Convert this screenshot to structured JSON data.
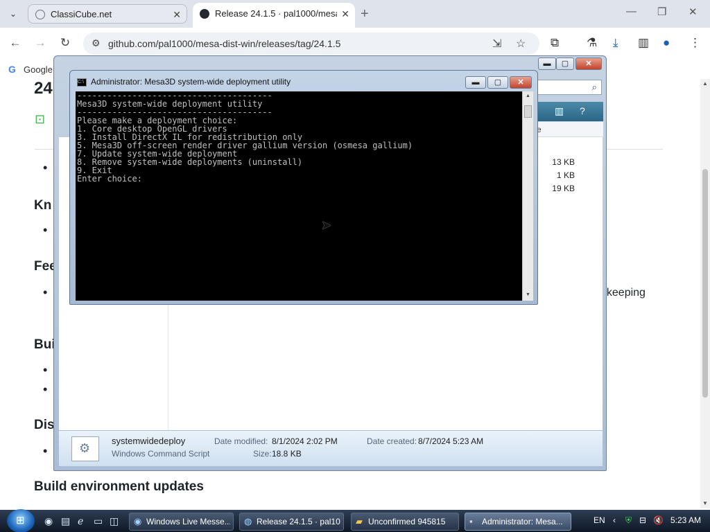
{
  "browser": {
    "tab_dropdown_icon": "chevron-down-icon",
    "tabs": [
      {
        "title": "ClassiCube.net",
        "close": "✕"
      },
      {
        "title": "Release 24.1.5 · pal1000/mesa",
        "close": "✕"
      }
    ],
    "new_tab": "+",
    "window_controls": {
      "minimize": "—",
      "restore": "❐",
      "close": "✕"
    },
    "nav": {
      "back": "←",
      "forward": "→",
      "reload": "↻"
    },
    "url": "github.com/pal1000/mesa-dist-win/releases/tag/24.1.5",
    "bookmark": {
      "label": "Google",
      "icon_letter": "G"
    }
  },
  "page": {
    "title_fragment": "24",
    "sections": [
      "Kn",
      "Fee",
      "Buil",
      "Dist",
      "Build environment updates"
    ],
    "partial_text_right": "f keeping"
  },
  "explorer": {
    "file_sizes": [
      "13 KB",
      "1 KB",
      "19 KB"
    ],
    "column_header_fragment": "e",
    "details": {
      "name": "systemwidedeploy",
      "type": "Windows Command Script",
      "date_modified_label": "Date modified:",
      "date_modified": "8/1/2024 2:02 PM",
      "size_label": "Size:",
      "size": "18.8 KB",
      "date_created_label": "Date created:",
      "date_created": "8/7/2024 5:23 AM"
    }
  },
  "cmd": {
    "title": "Administrator:  Mesa3D system-wide deployment utility",
    "console_lines": [
      "---------------------------------------",
      "Mesa3D system-wide deployment utility",
      "---------------------------------------",
      "Please make a deployment choice:",
      "1. Core desktop OpenGL drivers",
      "3. Install DirectX IL for redistribution only",
      "5. Mesa3D off-screen render driver gallium version (osmesa gallium)",
      "7. Update system-wide deployment",
      "8. Remove system-wide deployments (uninstall)",
      "9. Exit",
      "",
      "Enter choice:"
    ]
  },
  "taskbar": {
    "tasks": [
      {
        "label": "Windows Live Messe..."
      },
      {
        "label": "Release 24.1.5 · pal10..."
      },
      {
        "label": "Unconfirmed 945815"
      },
      {
        "label": "Administrator:  Mesa..."
      }
    ],
    "language": "EN",
    "time": "5:23 AM"
  }
}
